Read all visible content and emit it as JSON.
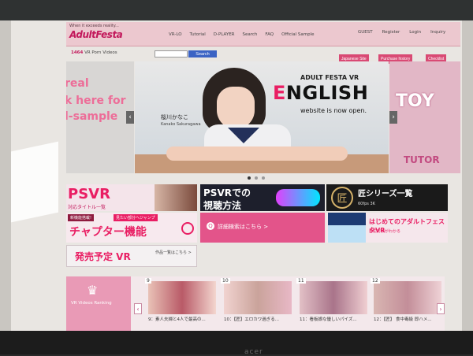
{
  "nav": {
    "tagline": "When it exceeds reality...",
    "logo_text": "AdultFesta",
    "links": [
      "VR-LO",
      "Tutorial",
      "D-PLAYER",
      "Search",
      "FAQ",
      "Official Sample"
    ],
    "right_links": [
      "GUEST",
      "Register",
      "Login",
      "Inquiry"
    ]
  },
  "subbar": {
    "count_number": "1464",
    "count_label": "VR Porn Videos",
    "search_placeholder": "",
    "search_button": "Search",
    "japanese_site": "Japanese Site",
    "purchase_history": "Purchase history",
    "checklist": "Checklist"
  },
  "hero": {
    "left_text_lines": [
      "real",
      "k here for",
      "l-sample"
    ],
    "title_top": "ADULT FESTA VR",
    "title_big_first": "E",
    "title_big_rest": "NGLISH",
    "subtitle": "website is now open.",
    "model_jp": "桜川かなこ",
    "model_en": "Kanako Sakuragawa",
    "right_toy": "TOY",
    "right_tutor": "TUTOR",
    "prev_arrow": "‹",
    "next_arrow": "›"
  },
  "tiles": {
    "psvr_big": "PSVR",
    "psvr_small": "対応タイトル一覧",
    "psvr2_line1": "PSVRでの",
    "psvr2_line2": "視聴方法",
    "takumi_badge": "匠",
    "takumi_title": "匠シリーズ一覧",
    "takumi_sub": "60fps 3K",
    "chapter_tag1": "新機能搭載!",
    "chapter_tag2": "見たい部分へジャンプ",
    "chapter_big": "チャプター機能",
    "detail_icon": "Q",
    "detail_text": "詳細検索はこちら >",
    "adult_line1": "はじめてのアダルトフェスタVR",
    "adult_line2": "再生方法がわかる",
    "release_big": "発売予定 VR",
    "release_small": "作品一覧はこちら >"
  },
  "ranking": {
    "label": "VR Videos Ranking",
    "crown": "♛",
    "prev": "‹",
    "next": "›",
    "items": [
      {
        "num": "9",
        "caption": "9：素人夫婦と4人で最高の..."
      },
      {
        "num": "10",
        "caption": "10：【匠】エロカワ過ぎる..."
      },
      {
        "num": "11",
        "caption": "11：看板娘な優しいパイズ..."
      },
      {
        "num": "12",
        "caption": "12：【匠】 食中毒級 即ハメ..."
      }
    ]
  },
  "device": {
    "brand": "acer"
  },
  "colors": {
    "accent": "#e91e63",
    "nav_bg": "#ecc8cf",
    "search_button": "#3b63c4"
  }
}
